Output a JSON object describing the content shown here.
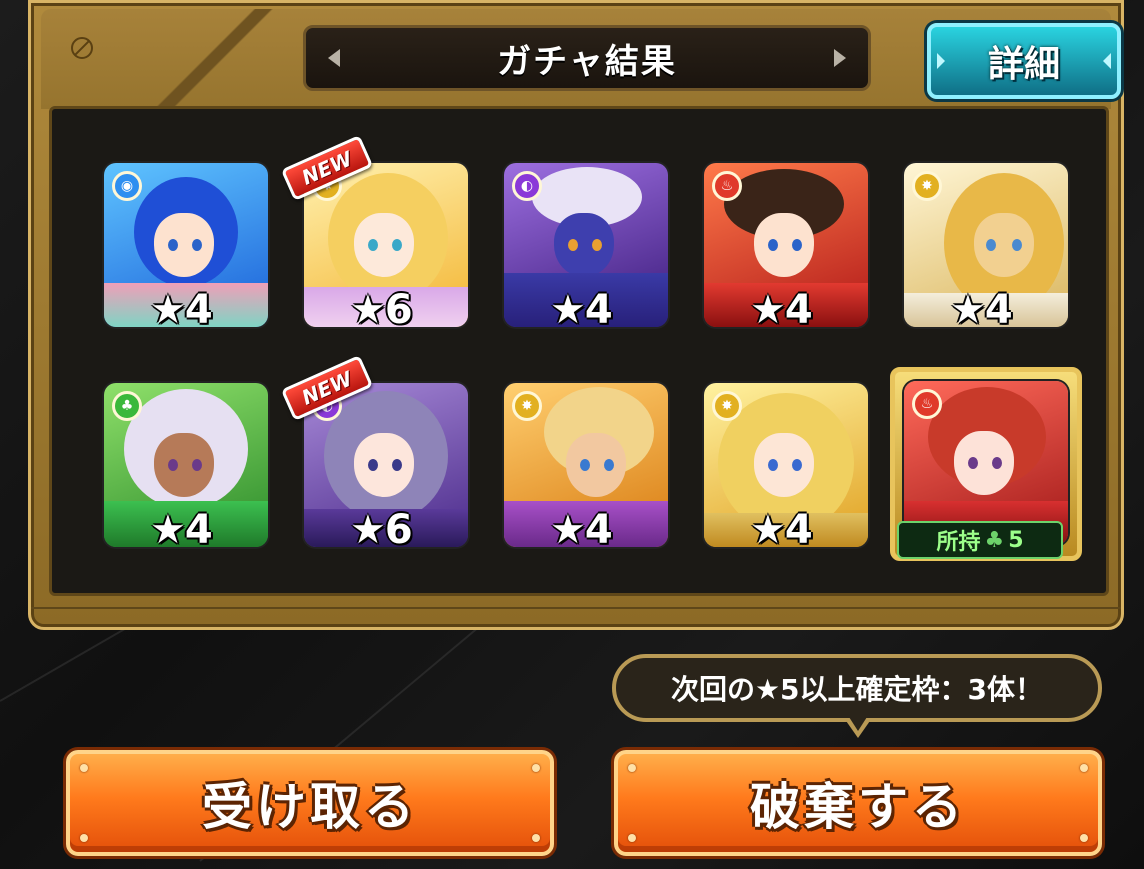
{
  "header": {
    "title": "ガチャ結果",
    "detail_label": "詳細"
  },
  "results": [
    {
      "rarity": "★4",
      "element": "water",
      "element_color": "#2e8ff0",
      "is_new": false
    },
    {
      "rarity": "★6",
      "element": "light",
      "element_color": "#e2b020",
      "is_new": true
    },
    {
      "rarity": "★4",
      "element": "dark",
      "element_color": "#8a38d8",
      "is_new": false
    },
    {
      "rarity": "★4",
      "element": "fire",
      "element_color": "#e03a2a",
      "is_new": false
    },
    {
      "rarity": "★4",
      "element": "light",
      "element_color": "#e2b020",
      "is_new": false
    },
    {
      "rarity": "★4",
      "element": "wood",
      "element_color": "#3bb83b",
      "is_new": false
    },
    {
      "rarity": "★6",
      "element": "dark",
      "element_color": "#8a38d8",
      "is_new": true
    },
    {
      "rarity": "★4",
      "element": "light",
      "element_color": "#e2b020",
      "is_new": false
    },
    {
      "rarity": "★4",
      "element": "light",
      "element_color": "#e2b020",
      "is_new": false
    },
    {
      "rarity": "",
      "element": "fire",
      "element_color": "#e03a2a",
      "is_new": false,
      "owned": "所持",
      "owned_count": "5"
    }
  ],
  "new_label": "NEW",
  "notice": "次回の★5以上確定枠：3体！",
  "buttons": {
    "receive": "受け取る",
    "discard": "破棄する"
  },
  "colors": {
    "accent_orange": "#ff7a1c",
    "detail_cyan": "#2ad3e0",
    "panel_gold": "#b08a3c"
  }
}
